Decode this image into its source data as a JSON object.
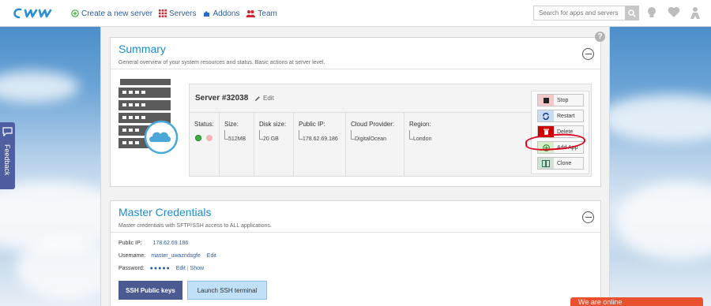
{
  "nav": {
    "create_server": "Create a new server",
    "servers": "Servers",
    "addons": "Addons",
    "team": "Team"
  },
  "search": {
    "placeholder": "Search for apps and servers"
  },
  "help_label": "?",
  "summary": {
    "title": "Summary",
    "subtitle": "General overview of your system resources and status. Basic actions at server level.",
    "server_name": "Server #32038",
    "edit_label": "Edit",
    "status_label": "Status:",
    "size_label": "Size:",
    "size_value": "512MB",
    "disk_label": "Disk size:",
    "disk_value": "20 GB",
    "ip_label": "Public IP:",
    "ip_value": "178.62.69.186",
    "provider_label": "Cloud Provider:",
    "provider_value": "DigitalOcean",
    "region_label": "Region:",
    "region_value": "London",
    "actions": [
      "Stop",
      "Restart",
      "Delete",
      "Add App",
      "Clone"
    ]
  },
  "credentials": {
    "title": "Master Credentials",
    "subtitle": "Master credentials with SFTP/SSH access to ALL applications.",
    "ip_label": "Public IP:",
    "ip_value": "178.62.69.186",
    "username_label": "Username:",
    "username_value": "master_uwazndsgfe",
    "username_edit": "Edit",
    "password_label": "Password:",
    "password_value": "●●●●●",
    "password_edit": "Edit",
    "password_separator": "|",
    "password_show": "Show",
    "ssh_keys_button": "SSH Public keys",
    "ssh_terminal_button": "Launch SSH terminal"
  },
  "feedback_label": "Feedback",
  "chat_label": "We are online",
  "colors": {
    "accent": "#1b8dcf",
    "link": "#2b5d9b",
    "nav_bg": "#4b5b92",
    "danger": "#cc0000",
    "status_ok": "#3cb043",
    "highlight": "#e0001b"
  }
}
